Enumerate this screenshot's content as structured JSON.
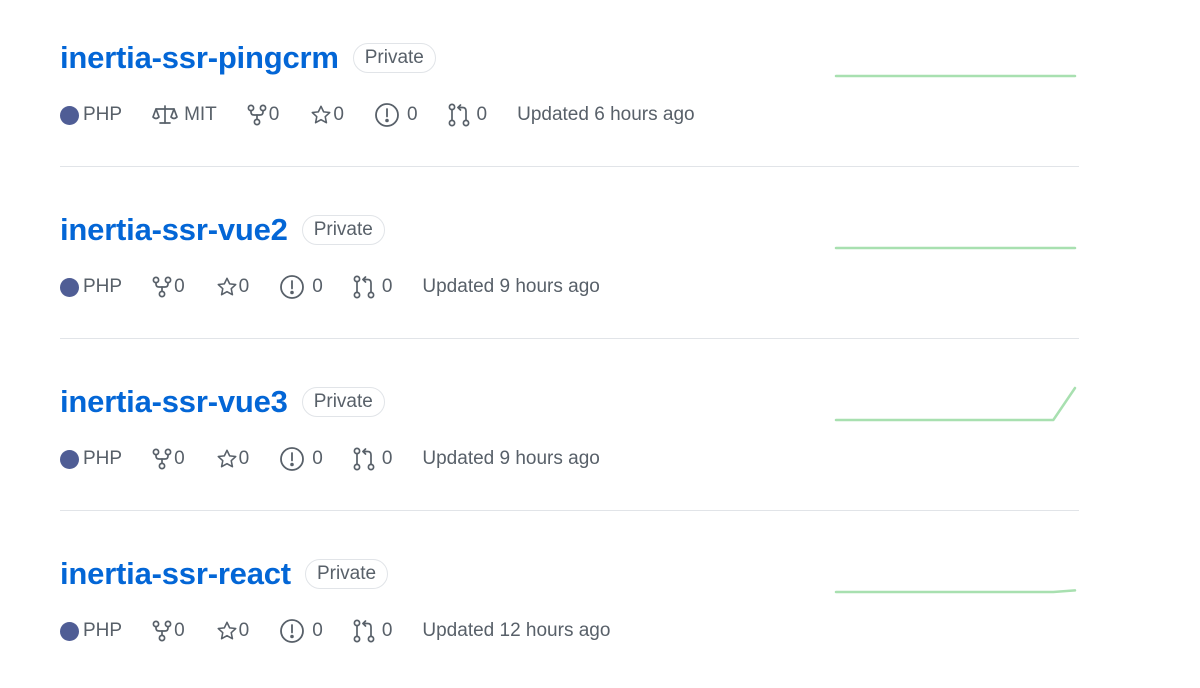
{
  "colors": {
    "link": "#0366d6",
    "php_language": "#4F5D95",
    "sparkline": "#a8e0b0",
    "muted": "#586069"
  },
  "repos": [
    {
      "name": "inertia-ssr-pingcrm",
      "visibility": "Private",
      "language": "PHP",
      "license": "MIT",
      "forks": "0",
      "stars": "0",
      "issues": "0",
      "pull_requests": "0",
      "updated": "Updated 6 hours ago",
      "activity": [
        0,
        0,
        0,
        0,
        0,
        0,
        0,
        0,
        0,
        0,
        0,
        0
      ]
    },
    {
      "name": "inertia-ssr-vue2",
      "visibility": "Private",
      "language": "PHP",
      "license": "",
      "forks": "0",
      "stars": "0",
      "issues": "0",
      "pull_requests": "0",
      "updated": "Updated 9 hours ago",
      "activity": [
        0,
        0,
        0,
        0,
        0,
        0,
        0,
        0,
        0,
        0,
        0,
        0
      ]
    },
    {
      "name": "inertia-ssr-vue3",
      "visibility": "Private",
      "language": "PHP",
      "license": "",
      "forks": "0",
      "stars": "0",
      "issues": "0",
      "pull_requests": "0",
      "updated": "Updated 9 hours ago",
      "activity": [
        0,
        0,
        0,
        0,
        0,
        0,
        0,
        0,
        0,
        0,
        0,
        1
      ]
    },
    {
      "name": "inertia-ssr-react",
      "visibility": "Private",
      "language": "PHP",
      "license": "",
      "forks": "0",
      "stars": "0",
      "issues": "0",
      "pull_requests": "0",
      "updated": "Updated 12 hours ago",
      "activity": [
        0,
        0,
        0,
        0,
        0,
        0,
        0,
        0,
        0,
        0,
        0,
        0.05
      ]
    }
  ]
}
